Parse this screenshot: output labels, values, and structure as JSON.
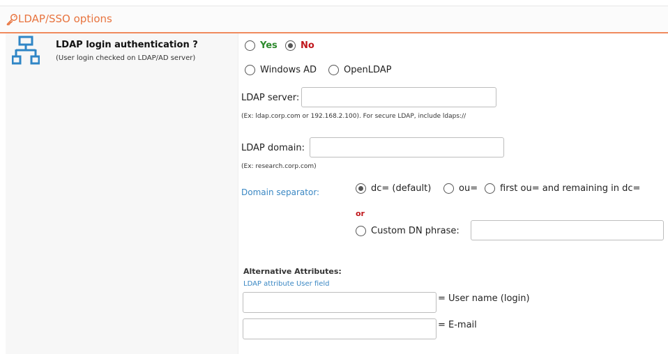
{
  "header": {
    "icon": "key-icon",
    "title": "LDAP/SSO options"
  },
  "option": {
    "icon": "network-icon",
    "title": "LDAP login authentication ?",
    "description": "(User login checked on LDAP/AD server)"
  },
  "auth": {
    "yes_label": "Yes",
    "no_label": "No",
    "selected": "No"
  },
  "server_type": {
    "windows_label": "Windows AD",
    "openldap_label": "OpenLDAP",
    "selected": ""
  },
  "ldap_server": {
    "label": "LDAP server:",
    "value": "",
    "hint": "(Ex: ldap.corp.com or 192.168.2.100). For secure LDAP, include ldaps://"
  },
  "ldap_domain": {
    "label": "LDAP domain:",
    "value": "",
    "hint": "(Ex: research.corp.com)"
  },
  "domain_separator": {
    "label": "Domain separator:",
    "options": [
      "dc= (default)",
      "ou=",
      "first ou= and remaining in dc="
    ],
    "selected": "dc= (default)",
    "or_label": "or",
    "custom_label": "Custom DN phrase:",
    "custom_value": ""
  },
  "alt_attributes": {
    "heading": "Alternative Attributes:",
    "subheading": "LDAP attribute User field",
    "username_suffix": "= User name (login)",
    "email_suffix": "= E-mail",
    "username_value": "",
    "email_value": ""
  },
  "colors": {
    "accent": "#e8743f",
    "yes": "#2d8a2d",
    "no": "#c0161b",
    "link": "#3a87c3",
    "icon": "#2f86c6"
  }
}
